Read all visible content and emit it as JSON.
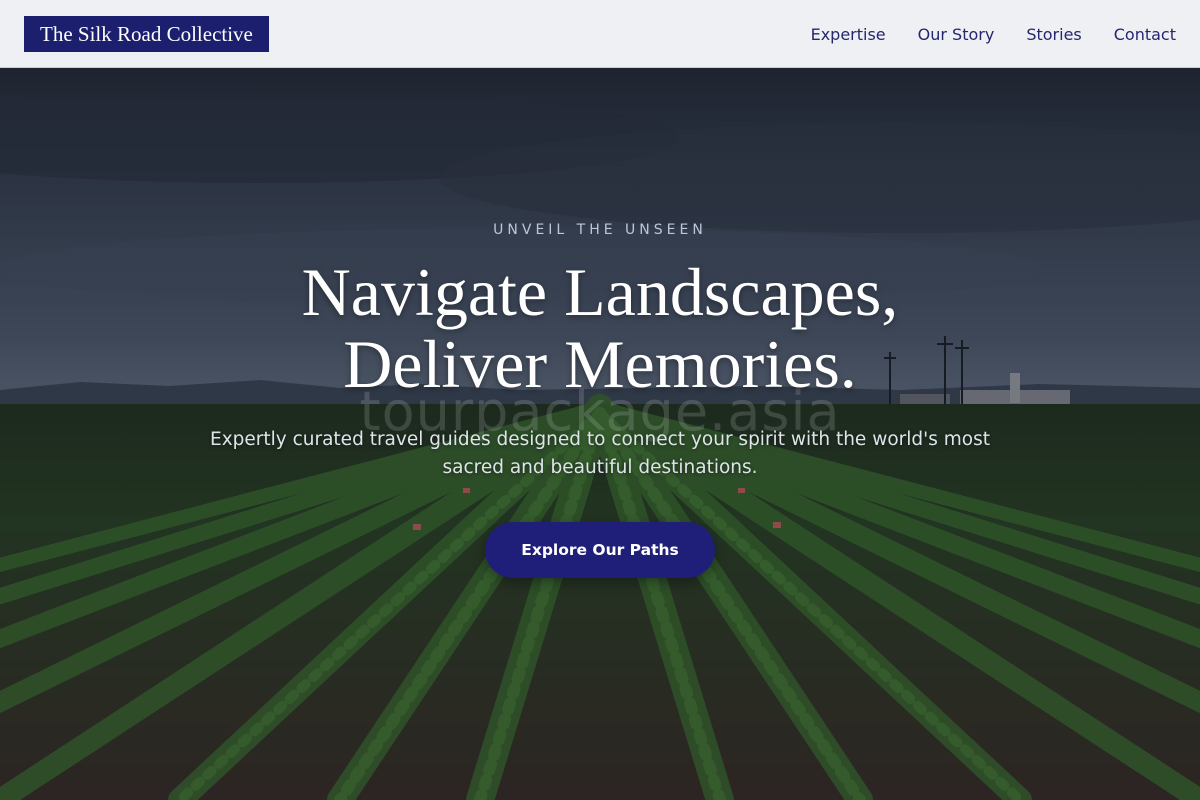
{
  "header": {
    "brand": "The Silk Road Collective",
    "nav": [
      {
        "label": "Expertise"
      },
      {
        "label": "Our Story"
      },
      {
        "label": "Stories"
      },
      {
        "label": "Contact"
      }
    ]
  },
  "hero": {
    "eyebrow": "UNVEIL THE UNSEEN",
    "headline_line1": "Navigate Landscapes,",
    "headline_line2": "Deliver Memories.",
    "subtitle": "Expertly curated travel guides designed to connect your spirit with the world's most sacred and beautiful destinations.",
    "cta_label": "Explore Our Paths",
    "watermark": "tourpackage.asia",
    "background_image": "agricultural-field-under-stormy-sky"
  },
  "colors": {
    "brand_navy": "#1c1f6e",
    "nav_text": "#24276e",
    "header_bg": "#eef0f3",
    "cta_bg": "#1f1f7a"
  }
}
